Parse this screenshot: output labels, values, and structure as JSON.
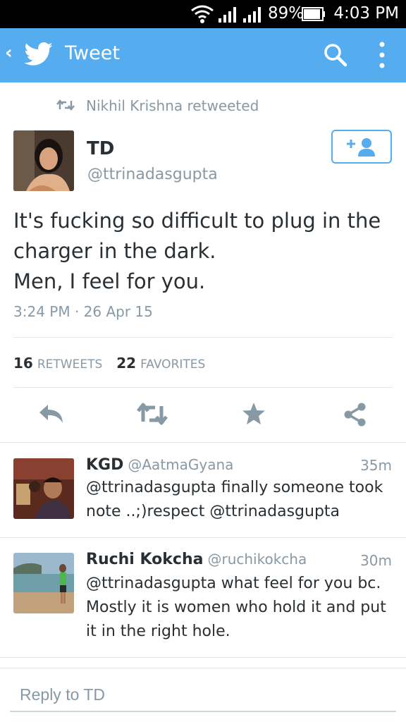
{
  "status_bar": {
    "battery": "89%",
    "time": "4:03 PM"
  },
  "app_bar": {
    "back": "‹",
    "title": "Tweet",
    "icons": [
      "twitter-bird-icon",
      "search-icon",
      "more-vert-icon"
    ]
  },
  "retweet_context": {
    "text": "Nikhil Krishna retweeted"
  },
  "tweet": {
    "author_name": "TD",
    "author_handle": "@ttrinadasgupta",
    "text": "It's fucking so difficult to plug in the charger in the dark.\nMen, I feel for you.",
    "timestamp": "3:24 PM · 26 Apr 15",
    "retweets_count": "16",
    "retweets_label": "RETWEETS",
    "favorites_count": "22",
    "favorites_label": "FAVORITES"
  },
  "actions": [
    "reply-icon",
    "retweet-icon",
    "favorite-icon",
    "share-icon"
  ],
  "colors": {
    "accent": "#55acee",
    "muted": "#8899a6",
    "text": "#292f33"
  },
  "replies": [
    {
      "name": "KGD",
      "handle": "@AatmaGyana",
      "time": "35m",
      "text": "@ttrinadasgupta finally someone took note ..;)respect @ttrinadasgupta"
    },
    {
      "name": "Ruchi Kokcha",
      "handle": "@ruchikokcha",
      "time": "30m",
      "text": "@ttrinadasgupta what feel for you bc. Mostly it is women who hold it and put it in the right hole."
    }
  ],
  "reply_box": {
    "placeholder": "Reply to TD"
  }
}
